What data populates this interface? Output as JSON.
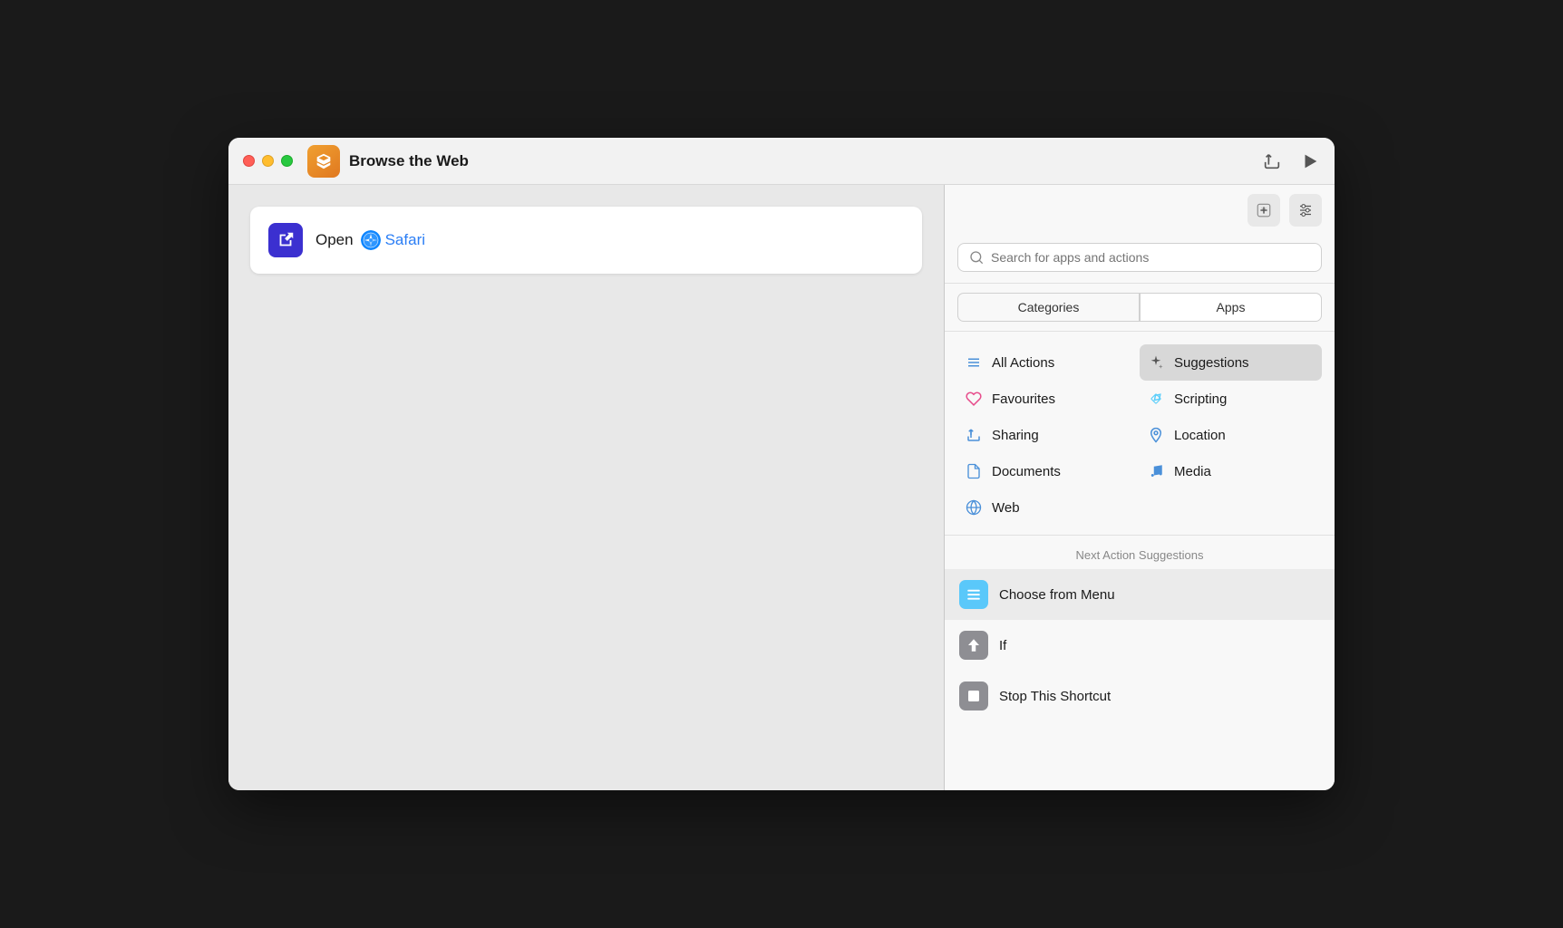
{
  "window": {
    "title": "Browse the Web",
    "traffic_lights": [
      "close",
      "minimize",
      "maximize"
    ]
  },
  "toolbar": {
    "share_label": "Share",
    "play_label": "Play"
  },
  "action_card": {
    "verb": "Open",
    "app_name": "Safari"
  },
  "sidebar": {
    "search_placeholder": "Search for apps and actions",
    "tabs": [
      {
        "label": "Categories",
        "active": false
      },
      {
        "label": "Apps",
        "active": false
      }
    ],
    "categories": [
      {
        "label": "All Actions",
        "icon": "list-icon",
        "active": false
      },
      {
        "label": "Suggestions",
        "icon": "sparkle-icon",
        "active": true
      },
      {
        "label": "Favourites",
        "icon": "heart-icon",
        "active": false
      },
      {
        "label": "Scripting",
        "icon": "diamond-icon",
        "active": false
      },
      {
        "label": "Sharing",
        "icon": "share-icon",
        "active": false
      },
      {
        "label": "Location",
        "icon": "location-icon",
        "active": false
      },
      {
        "label": "Documents",
        "icon": "doc-icon",
        "active": false
      },
      {
        "label": "Media",
        "icon": "music-icon",
        "active": false
      },
      {
        "label": "Web",
        "icon": "web-icon",
        "active": false
      }
    ],
    "suggestions_header": "Next Action Suggestions",
    "suggestions": [
      {
        "label": "Choose from Menu",
        "icon_color": "blue"
      },
      {
        "label": "If",
        "icon_color": "gray"
      },
      {
        "label": "Stop This Shortcut",
        "icon_color": "gray"
      }
    ]
  }
}
